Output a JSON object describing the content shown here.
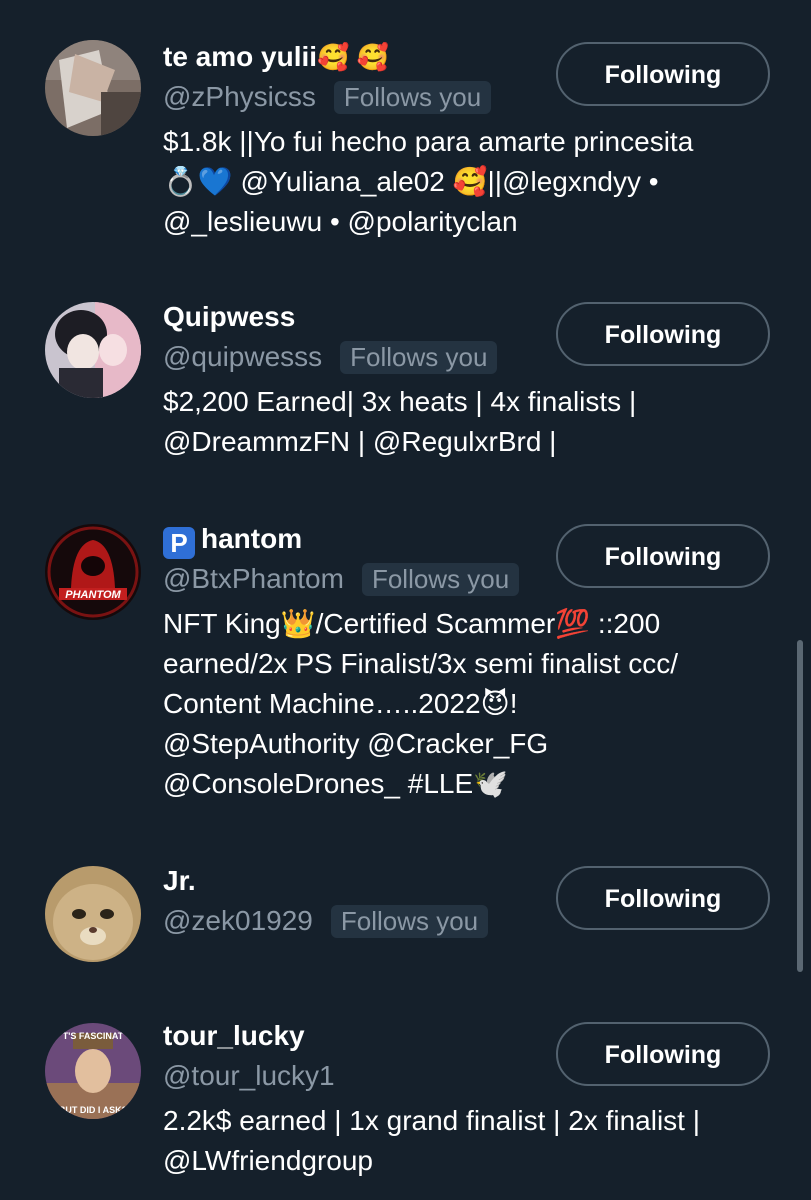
{
  "users": [
    {
      "name": "te amo yulii",
      "name_suffix": "🥰 🥰",
      "handle": "@zPhysicss",
      "follows_you": "Follows you",
      "bio": [
        "$1.8k ||Yo fui hecho para amarte princesita",
        "💍💙 @Yuliana_ale02 🥰||@legxndyy •",
        "@_leslieuwu • @polarityclan"
      ],
      "button": "Following"
    },
    {
      "name": "Quipwess",
      "handle": "@quipwesss",
      "follows_you": "Follows you",
      "bio": [
        "$2,200 Earned| 3x heats | 4x finalists |",
        "@DreammzFN | @RegulxrBrd |"
      ],
      "button": "Following"
    },
    {
      "name_prefix": "P",
      "name": "hantom",
      "handle": "@BtxPhantom",
      "follows_you": "Follows you",
      "bio": [
        "NFT King👑/Certified Scammer💯 ::200",
        "earned/2x PS Finalist/3x semi finalist ccc/",
        "Content Machine…..2022😈!",
        "@StepAuthority @Cracker_FG",
        "@ConsoleDrones_ #LLE🕊️"
      ],
      "avatar_text": "PHANTOM",
      "button": "Following"
    },
    {
      "name": "Jr.",
      "handle": "@zek01929",
      "follows_you": "Follows you",
      "bio": [],
      "button": "Following"
    },
    {
      "name": "tour_lucky",
      "handle": "@tour_lucky1",
      "bio": [
        "2.2k$ earned | 1x grand finalist | 2x finalist |",
        "@LWfriendgroup"
      ],
      "avatar_top_text": "T'S FASCINAT",
      "avatar_bottom_text": "BUT DID I ASK?",
      "button": "Following"
    }
  ],
  "colors": {
    "background": "#15202b",
    "secondary_text": "#8b98a5",
    "button_border": "#53626f"
  }
}
